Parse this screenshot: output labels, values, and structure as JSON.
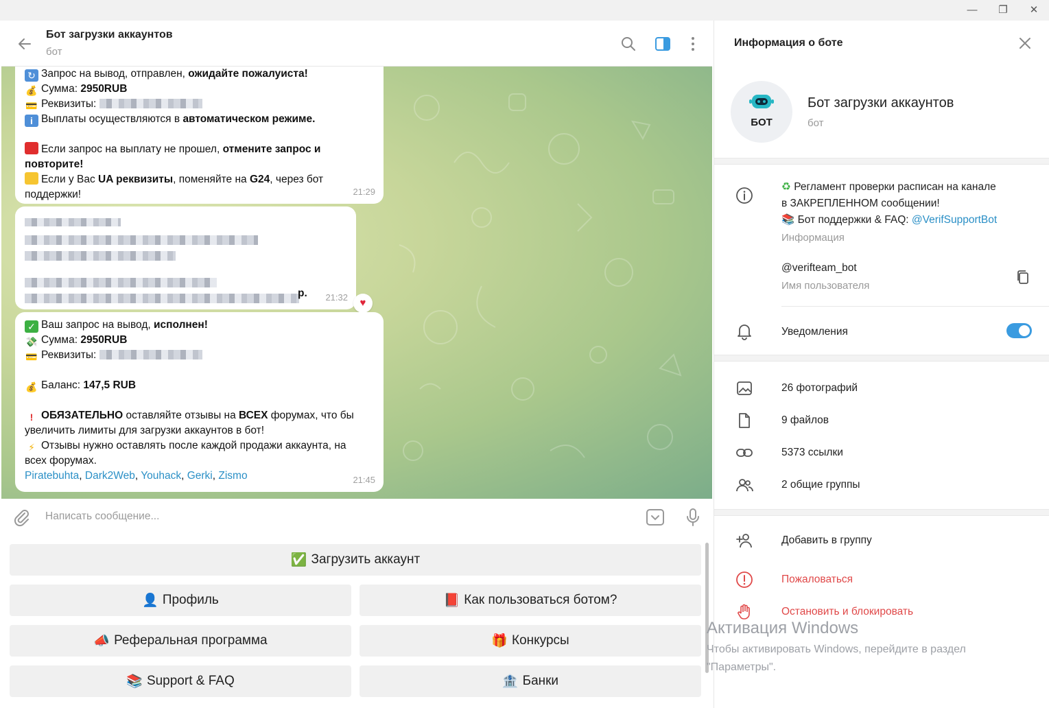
{
  "window": {
    "minimize": "—",
    "maximize": "❐",
    "close": "✕"
  },
  "header": {
    "title": "Бот загрузки аккаунтов",
    "subtitle": "бот"
  },
  "messages": [
    {
      "lines": [
        {
          "pre": "Запрос на вывод,  отправлен, ",
          "bold": "ожидайте пожалуиста!"
        },
        {
          "pre": "Сумма: ",
          "bold": "2950RUB"
        },
        {
          "pre": "Реквизиты: "
        },
        {
          "pre": "Выплаты осуществляются в ",
          "bold": "автоматическом режиме."
        },
        {
          "pre": "Если запрос на выплату не прошел, ",
          "bold": "отмените запрос и"
        },
        {
          "bold": "повторите!"
        },
        {
          "pre": "Если у Вас ",
          "bold": "UA реквизиты",
          "post": ", поменяйте на ",
          "bold2": "G24",
          "post2": ", через бот"
        },
        {
          "pre": "поддержки!"
        }
      ],
      "time": "21:29"
    },
    {
      "tail": "р.",
      "time": "21:32",
      "reaction": "♥"
    },
    {
      "lines": [
        {
          "pre": "Ваш запрос на вывод, ",
          "bold": "исполнен!"
        },
        {
          "pre": "Сумма: ",
          "bold": "2950RUB"
        },
        {
          "pre": "Реквизиты: "
        },
        {
          "pre": "Баланс: ",
          "bold": "147,5 RUB"
        },
        {
          "bold": "ОБЯЗАТЕЛЬНО",
          "post": " оставляйте отзывы на ",
          "bold2": "ВСЕХ",
          "post2": " форумах, что бы"
        },
        {
          "pre": "увеличить лимиты для загрузки аккаунтов в бот!"
        },
        {
          "pre": "Отзывы нужно оставлять после каждой продажи аккаунта, на"
        },
        {
          "pre": "всех форумах."
        }
      ],
      "links": [
        "Piratebuhta",
        "Dark2Web",
        "Youhack",
        "Gerki",
        "Zismo"
      ],
      "time": "21:45"
    }
  ],
  "composer": {
    "placeholder": "Написать сообщение..."
  },
  "keyboard": [
    {
      "emoji": "✅",
      "label": "Загрузить аккаунт"
    },
    {
      "emoji": "👤",
      "label": "Профиль"
    },
    {
      "emoji": "📕",
      "label": "Как пользоваться ботом?"
    },
    {
      "emoji": "📣",
      "label": "Реферальная программа"
    },
    {
      "emoji": "🎁",
      "label": "Конкурсы"
    },
    {
      "emoji": "📚",
      "label": "Support & FAQ"
    },
    {
      "emoji": "🏦",
      "label": "Банки"
    }
  ],
  "info": {
    "title": "Информация о боте",
    "avatar_label": "БОТ",
    "name": "Бот загрузки аккаунтов",
    "subtitle": "бот",
    "about_line1": "Регламент проверки расписан на канале",
    "about_line2": "в ЗАКРЕПЛЕННОМ сообщении!",
    "about_line3": "Бот поддержки & FAQ: ",
    "about_link": "@VerifSupportBot",
    "about_caption": "Информация",
    "username": "@verifteam_bot",
    "username_caption": "Имя пользователя",
    "notifications": "Уведомления",
    "notifications_on": true,
    "media": [
      "26 фотографий",
      "9 файлов",
      "5373 ссылки",
      "2 общие группы"
    ],
    "add_to_group": "Добавить в группу",
    "report": "Пожаловаться",
    "block": "Остановить и блокировать"
  },
  "watermark": {
    "title": "Активация Windows",
    "line1": "Чтобы активировать Windows, перейдите в раздел",
    "line2": "\"Параметры\"."
  },
  "colors": {
    "accent": "#3a9be0",
    "link": "#2a8fc6",
    "danger": "#e04848"
  }
}
